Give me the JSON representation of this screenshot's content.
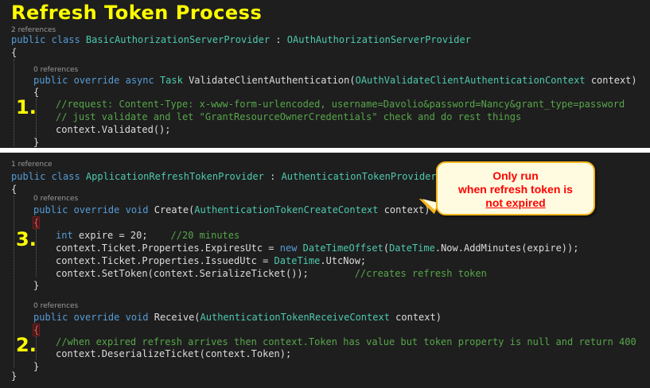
{
  "title": "Refresh Token Process",
  "panel1": {
    "class_refs": "2 references",
    "class_decl": {
      "kw": "public class ",
      "name": "BasicAuthorizationServerProvider",
      "sep": " : ",
      "base": "OAuthAuthorizationServerProvider"
    },
    "open_brace": "{",
    "method_refs": "0 references",
    "method_decl": {
      "kw": "public override async ",
      "ret": "Task",
      "name": " ValidateClientAuthentication(",
      "param_type": "OAuthValidateClientAuthenticationContext",
      "param": " context)"
    },
    "method_open": "{",
    "step": "1.",
    "comment1": "//request: Content-Type: x-www-form-urlencoded, username=Davolio&password=Nancy&grant_type=password",
    "comment2": "// just validate and let \"GrantResourceOwnerCredentials\" check and do rest things",
    "call": "context.Validated();",
    "method_close": "}"
  },
  "panel2": {
    "class_refs": "1 reference",
    "class_decl": {
      "kw": "public class ",
      "name": "ApplicationRefreshTokenProvider",
      "sep": " : ",
      "base": "AuthenticationTokenProvider"
    },
    "open_brace": "{",
    "create_refs": "0 references",
    "create_decl": {
      "kw": "public override void ",
      "name": "Create(",
      "param_type": "AuthenticationTokenCreateContext",
      "param": " context)"
    },
    "create_open": "{",
    "step_create": "3.",
    "create_lines": {
      "l1_kw": "int",
      "l1_rest": " expire = 20;",
      "l1_cm": "//20 minutes",
      "l2_a": "context.Ticket.Properties.ExpiresUtc = ",
      "l2_kw": "new",
      "l2_ty": " DateTimeOffset",
      "l2_b": "(",
      "l2_ty2": "DateTime",
      "l2_c": ".Now.AddMinutes(expire));",
      "l3_a": "context.Ticket.Properties.IssuedUtc = ",
      "l3_ty": "DateTime",
      "l3_b": ".UtcNow;",
      "l4_a": "context.SetToken(context.SerializeTicket());",
      "l4_cm": "//creates refresh token"
    },
    "create_close": "}",
    "receive_refs": "0 references",
    "receive_decl": {
      "kw": "public override void ",
      "name": "Receive(",
      "param_type": "AuthenticationTokenReceiveContext",
      "param": " context)"
    },
    "receive_open": "{",
    "step_receive": "2.",
    "receive_comment": "//when expired refresh arrives then context.Token has value but token property is null and return 400",
    "receive_call": "context.DeserializeTicket(context.Token);",
    "receive_close": "}",
    "class_close": "}"
  },
  "callout": {
    "line1": "Only run",
    "line2": "when refresh token is",
    "line3": "not expired"
  }
}
